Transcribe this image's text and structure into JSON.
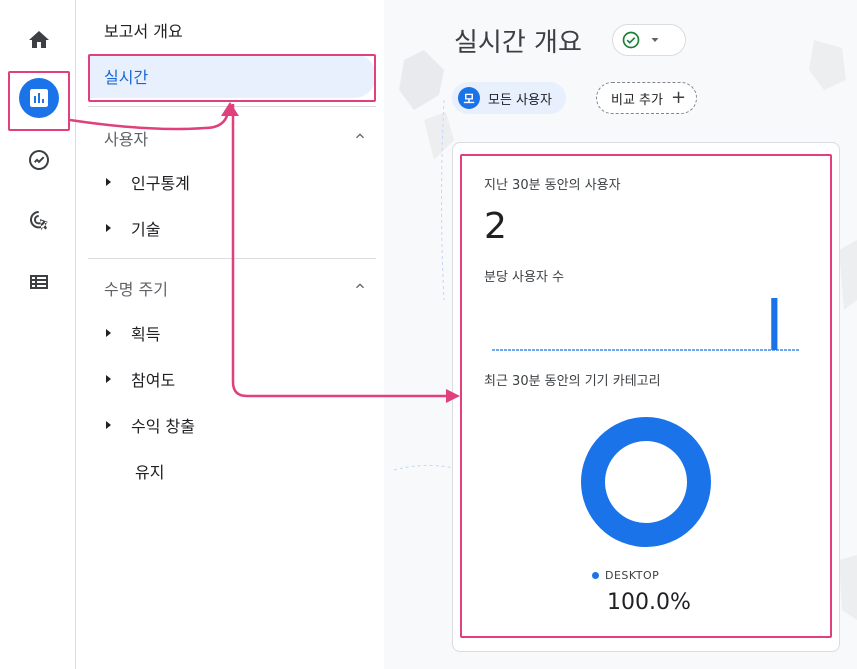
{
  "nav": {
    "overview": "보고서 개요",
    "realtime": "실시간",
    "users_section": "사용자",
    "demographics": "인구통계",
    "tech": "기술",
    "lifecycle_section": "수명 주기",
    "acquisition": "획득",
    "engagement": "참여도",
    "monetization": "수익 창출",
    "retention": "유지"
  },
  "page": {
    "title": "실시간 개요"
  },
  "filters": {
    "segment_badge": "모",
    "segment_label": "모든 사용자",
    "compare_label": "비교 추가"
  },
  "card": {
    "users_title": "지난 30분 동안의 사용자",
    "users_value": "2",
    "per_minute_title": "분당 사용자 수",
    "device_title": "최근 30분 동안의 기기 카테고리",
    "device_legend": "DESKTOP",
    "device_pct": "100.0%"
  },
  "colors": {
    "accent": "#1a73e8",
    "annotation": "#e0407b",
    "selected_bg": "#e8f0fe"
  },
  "icons": [
    "home-icon",
    "reports-icon",
    "explore-icon",
    "advertising-icon",
    "configure-icon",
    "check-circle-icon",
    "dropdown-icon",
    "chevron-up-icon",
    "plus-icon"
  ],
  "chart_data": [
    {
      "type": "bar",
      "title": "분당 사용자 수",
      "categories": [
        "-30",
        "-29",
        "-28",
        "-27",
        "-26",
        "-25",
        "-24",
        "-23",
        "-22",
        "-21",
        "-20",
        "-19",
        "-18",
        "-17",
        "-16",
        "-15",
        "-14",
        "-13",
        "-12",
        "-11",
        "-10",
        "-9",
        "-8",
        "-7",
        "-6",
        "-5",
        "-4",
        "-3",
        "-2",
        "-1"
      ],
      "values": [
        0,
        0,
        0,
        0,
        0,
        0,
        0,
        0,
        0,
        0,
        0,
        0,
        0,
        0,
        0,
        0,
        0,
        0,
        0,
        0,
        0,
        0,
        0,
        0,
        0,
        0,
        0,
        2,
        0,
        0
      ]
    },
    {
      "type": "pie",
      "title": "최근 30분 동안의 기기 카테고리",
      "categories": [
        "DESKTOP"
      ],
      "values": [
        100.0
      ]
    }
  ]
}
